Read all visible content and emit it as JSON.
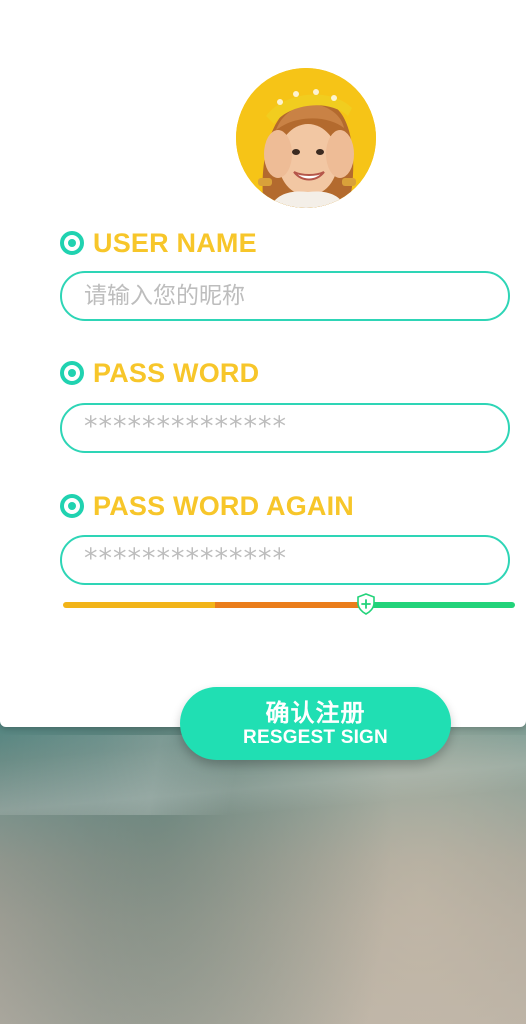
{
  "form": {
    "username": {
      "label": "USER NAME",
      "placeholder": "请输入您的昵称",
      "value": ""
    },
    "password": {
      "label": "PASS WORD",
      "placeholder": "**************",
      "value": ""
    },
    "password_again": {
      "label": "PASS WORD AGAIN",
      "placeholder": "**************",
      "value": ""
    }
  },
  "strength_meter": {
    "level": 0.67,
    "segment_colors": [
      "#f2b418",
      "#ea7d1a",
      "#22d37a"
    ]
  },
  "register_button": {
    "label_cn": "确认注册",
    "label_en": "RESGEST SIGN"
  },
  "colors": {
    "accent_teal": "#20d2b0",
    "label_yellow": "#f7c62a",
    "button_teal": "#20dfb3",
    "card_bg": "#ffffff"
  },
  "icons": {
    "label_icon": "radio-target-icon",
    "strength_handle": "shield-plus-icon"
  }
}
